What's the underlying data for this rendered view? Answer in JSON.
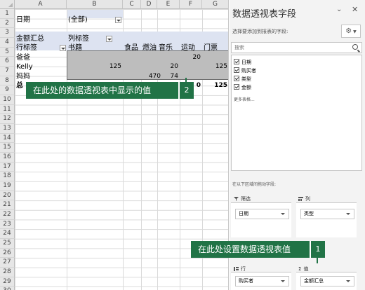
{
  "sheet": {
    "columns": [
      "A",
      "B",
      "C",
      "D",
      "E",
      "F",
      "G"
    ],
    "rows": [
      "1",
      "2",
      "3",
      "4",
      "5",
      "6",
      "7",
      "8",
      "9",
      "10",
      "11",
      "12",
      "13",
      "14",
      "15",
      "16",
      "17",
      "18",
      "19",
      "20",
      "21",
      "22",
      "23",
      "24",
      "25",
      "26",
      "27",
      "28",
      "29",
      "30"
    ],
    "cells": {
      "a1": "日期",
      "b1": "(全部)",
      "a3": "金额汇总",
      "b3": "列标签",
      "a4": "行标签",
      "b4": "书籍",
      "c4": "食品",
      "d4": "燃油",
      "e4": "音乐",
      "f4": "运动",
      "g4": "门票",
      "a5": "爸爸",
      "f5": "20",
      "a6": "Kelly",
      "b6": "125",
      "e6": "20",
      "g6": "125",
      "a7": "妈妈",
      "c7": "470",
      "d7": "74",
      "a8": "总",
      "f8": "0",
      "g8": "125"
    }
  },
  "callouts": {
    "values_hint": "在此处的数据透视表中显示的值",
    "values_badge": "2",
    "setup_hint": "在此处设置数据透视表值",
    "setup_badge": "1"
  },
  "pane": {
    "title": "数据透视表字段",
    "subtitle": "选择要添加到报表的字段:",
    "search_placeholder": "搜索",
    "fields": [
      {
        "label": "日期",
        "checked": true
      },
      {
        "label": "购买者",
        "checked": true
      },
      {
        "label": "类型",
        "checked": true
      },
      {
        "label": "金额",
        "checked": true
      }
    ],
    "more_tables": "更多表格...",
    "drag_hint": "在以下区域间拖动字段:",
    "areas": {
      "filters": {
        "label": "筛选",
        "item": "日期"
      },
      "columns": {
        "label": "列",
        "item": "类型"
      },
      "rows": {
        "label": "行",
        "item": "购买者"
      },
      "values": {
        "label": "值",
        "item": "金额汇总"
      }
    },
    "icons": {
      "dropdown": "chevron-down-icon",
      "close": "close-icon",
      "settings": "gear-icon",
      "search": "search-icon"
    }
  },
  "colors": {
    "accent": "#217346",
    "pivot_header": "#dde3f1",
    "selection": "#bdbdbd"
  }
}
